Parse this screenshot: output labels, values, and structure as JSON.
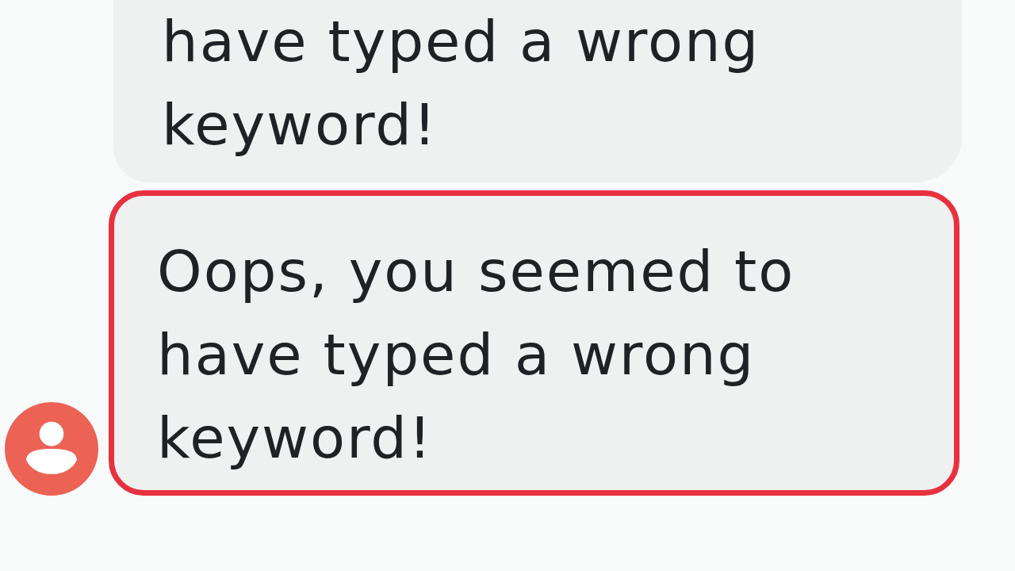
{
  "messages": [
    {
      "text": "have typed a wrong keyword!",
      "avatar": false,
      "highlighted": false
    },
    {
      "text": "Oops, you seemed to have typed a wrong keyword!",
      "avatar": true,
      "highlighted": true
    }
  ]
}
